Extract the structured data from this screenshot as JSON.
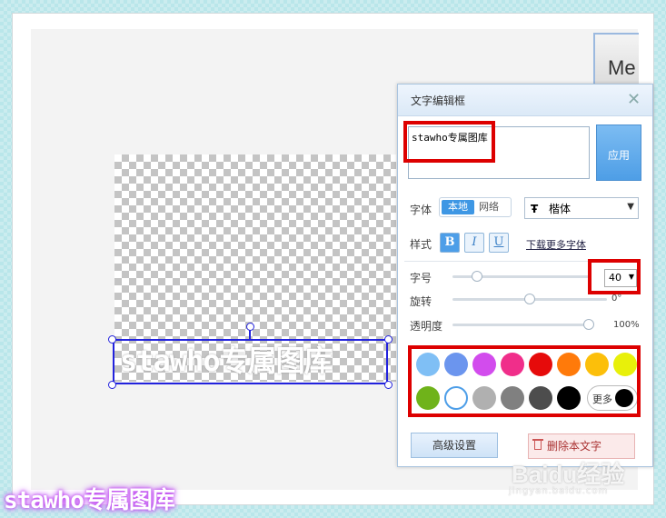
{
  "me_button_label": "Me",
  "canvas_text": "stawho专属图库",
  "dialog": {
    "title": "文字编辑框",
    "close_symbol": "✕",
    "text_value": "stawho专属图库",
    "apply_label": "应用",
    "font_label": "字体",
    "font_local": "本地",
    "font_net": "网络",
    "font_icon": "Ŧ",
    "font_name": "楷体",
    "style_label": "样式",
    "bold": "B",
    "italic": "I",
    "underline": "U",
    "more_fonts_link": "下载更多字体",
    "size_label": "字号",
    "size_value": "40",
    "size_level": 0.15,
    "rotate_label": "旋转",
    "rotate_value": "0°",
    "rotate_level": 0.5,
    "opacity_label": "透明度",
    "opacity_value": "100%",
    "opacity_level": 1.0,
    "colors": [
      "#7fbff5",
      "#6b95ee",
      "#d24ced",
      "#f02e8a",
      "#e60b0b",
      "#ff7a0a",
      "#fcbf0a",
      "#e8f00a",
      "#6fb31a",
      "#ffffff",
      "#b0b0b0",
      "#808080",
      "#4d4d4d",
      "#000000"
    ],
    "selected_color": "#ffffff",
    "more_label": "更多",
    "more_color": "#000000",
    "advanced_label": "高级设置",
    "delete_label": "删除本文字"
  },
  "baidu_logo": "Baidu经验",
  "baidu_sub": "jingyan.baidu.com",
  "watermark": "stawho专属图库"
}
